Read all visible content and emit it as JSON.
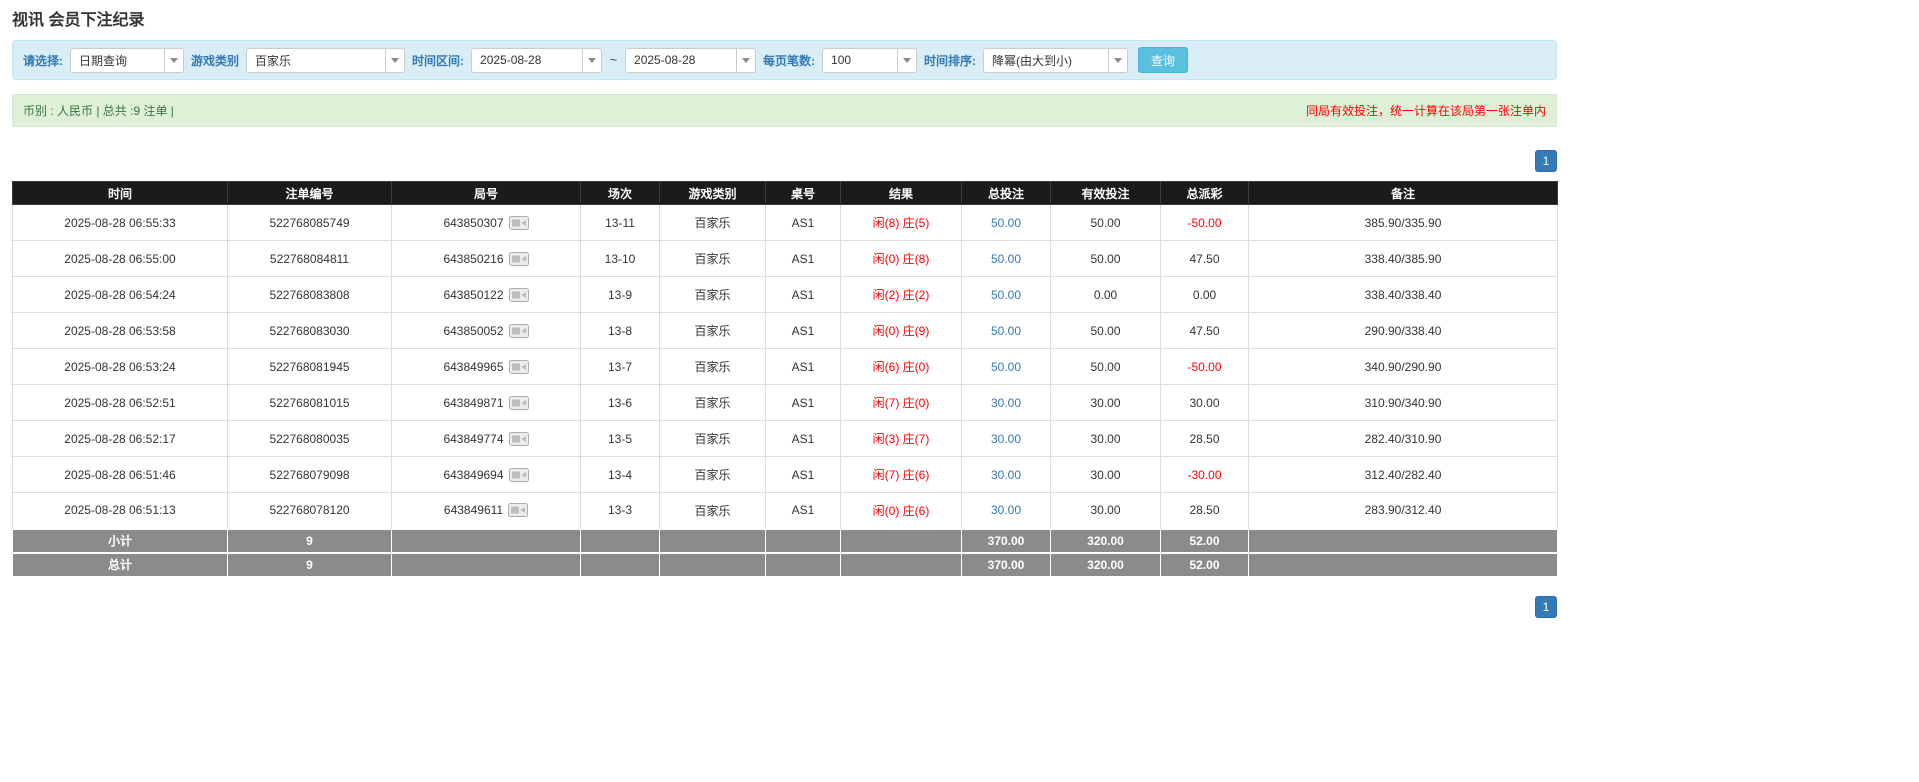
{
  "page_title": "视讯 会员下注纪录",
  "filter": {
    "select_label": "请选择:",
    "select_value": "日期查询",
    "game_label": "游戏类别",
    "game_value": "百家乐",
    "range_label": "时间区间:",
    "date_from": "2025-08-28",
    "range_separator": "~",
    "date_to": "2025-08-28",
    "per_page_label": "每页笔数:",
    "per_page_value": "100",
    "sort_label": "时间排序:",
    "sort_value": "降幂(由大到小)",
    "search_button": "查询"
  },
  "summary": {
    "currency_info": "币别 : 人民币 | 总共 :9 注单 |",
    "note": "同局有效投注，统一计算在该局第一张注单内"
  },
  "pagination": {
    "current_page": "1"
  },
  "table": {
    "headers": [
      "时间",
      "注单编号",
      "局号",
      "场次",
      "游戏类别",
      "桌号",
      "结果",
      "总投注",
      "有效投注",
      "总派彩",
      "备注"
    ],
    "rows": [
      {
        "time": "2025-08-28 06:55:33",
        "bet_id": "522768085749",
        "round_id": "643850307",
        "session": "13-11",
        "game": "百家乐",
        "table_no": "AS1",
        "result_player": "闲(8)",
        "result_banker": "庄(5)",
        "total_bet": "50.00",
        "valid_bet": "50.00",
        "payout": "-50.00",
        "note": "385.90/335.90"
      },
      {
        "time": "2025-08-28 06:55:00",
        "bet_id": "522768084811",
        "round_id": "643850216",
        "session": "13-10",
        "game": "百家乐",
        "table_no": "AS1",
        "result_player": "闲(0)",
        "result_banker": "庄(8)",
        "total_bet": "50.00",
        "valid_bet": "50.00",
        "payout": "47.50",
        "note": "338.40/385.90"
      },
      {
        "time": "2025-08-28 06:54:24",
        "bet_id": "522768083808",
        "round_id": "643850122",
        "session": "13-9",
        "game": "百家乐",
        "table_no": "AS1",
        "result_player": "闲(2)",
        "result_banker": "庄(2)",
        "total_bet": "50.00",
        "valid_bet": "0.00",
        "payout": "0.00",
        "note": "338.40/338.40"
      },
      {
        "time": "2025-08-28 06:53:58",
        "bet_id": "522768083030",
        "round_id": "643850052",
        "session": "13-8",
        "game": "百家乐",
        "table_no": "AS1",
        "result_player": "闲(0)",
        "result_banker": "庄(9)",
        "total_bet": "50.00",
        "valid_bet": "50.00",
        "payout": "47.50",
        "note": "290.90/338.40"
      },
      {
        "time": "2025-08-28 06:53:24",
        "bet_id": "522768081945",
        "round_id": "643849965",
        "session": "13-7",
        "game": "百家乐",
        "table_no": "AS1",
        "result_player": "闲(6)",
        "result_banker": "庄(0)",
        "total_bet": "50.00",
        "valid_bet": "50.00",
        "payout": "-50.00",
        "note": "340.90/290.90"
      },
      {
        "time": "2025-08-28 06:52:51",
        "bet_id": "522768081015",
        "round_id": "643849871",
        "session": "13-6",
        "game": "百家乐",
        "table_no": "AS1",
        "result_player": "闲(7)",
        "result_banker": "庄(0)",
        "total_bet": "30.00",
        "valid_bet": "30.00",
        "payout": "30.00",
        "note": "310.90/340.90"
      },
      {
        "time": "2025-08-28 06:52:17",
        "bet_id": "522768080035",
        "round_id": "643849774",
        "session": "13-5",
        "game": "百家乐",
        "table_no": "AS1",
        "result_player": "闲(3)",
        "result_banker": "庄(7)",
        "total_bet": "30.00",
        "valid_bet": "30.00",
        "payout": "28.50",
        "note": "282.40/310.90"
      },
      {
        "time": "2025-08-28 06:51:46",
        "bet_id": "522768079098",
        "round_id": "643849694",
        "session": "13-4",
        "game": "百家乐",
        "table_no": "AS1",
        "result_player": "闲(7)",
        "result_banker": "庄(6)",
        "total_bet": "30.00",
        "valid_bet": "30.00",
        "payout": "-30.00",
        "note": "312.40/282.40"
      },
      {
        "time": "2025-08-28 06:51:13",
        "bet_id": "522768078120",
        "round_id": "643849611",
        "session": "13-3",
        "game": "百家乐",
        "table_no": "AS1",
        "result_player": "闲(0)",
        "result_banker": "庄(6)",
        "total_bet": "30.00",
        "valid_bet": "30.00",
        "payout": "28.50",
        "note": "283.90/312.40"
      }
    ],
    "subtotal": {
      "label": "小计",
      "count": "9",
      "total_bet": "370.00",
      "valid_bet": "320.00",
      "payout": "52.00"
    },
    "total": {
      "label": "总计",
      "count": "9",
      "total_bet": "370.00",
      "valid_bet": "320.00",
      "payout": "52.00"
    }
  },
  "colors": {
    "accent_blue": "#337ab7",
    "search_button_cyan": "#5bc0de",
    "negative_red": "#ff0000",
    "result_red": "#ff0000",
    "table_header_bg": "#1b1b1b",
    "footer_row_gray": "#8b8b8b",
    "filter_bar_bg": "#d9edf7",
    "summary_bar_bg": "#dff0d8"
  }
}
